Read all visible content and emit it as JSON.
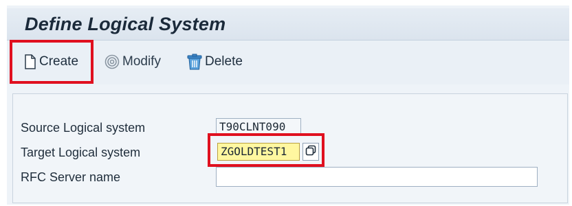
{
  "header": {
    "title": "Define Logical System"
  },
  "toolbar": {
    "create_label": "Create",
    "modify_label": "Modify",
    "delete_label": "Delete",
    "icons": {
      "create": "new-document-icon",
      "modify": "spiral-modify-icon",
      "delete": "trash-can-icon"
    }
  },
  "form": {
    "source": {
      "label": "Source Logical system",
      "value": "T90CLNT090"
    },
    "target": {
      "label": "Target Logical system",
      "value": "ZGOLDTEST1"
    },
    "rfc": {
      "label": "RFC Server name",
      "value": ""
    }
  },
  "colors": {
    "highlight": "#e0101f",
    "target_field_bg": "#fff7a0",
    "title_bar_bg": "#dbe4ee"
  }
}
